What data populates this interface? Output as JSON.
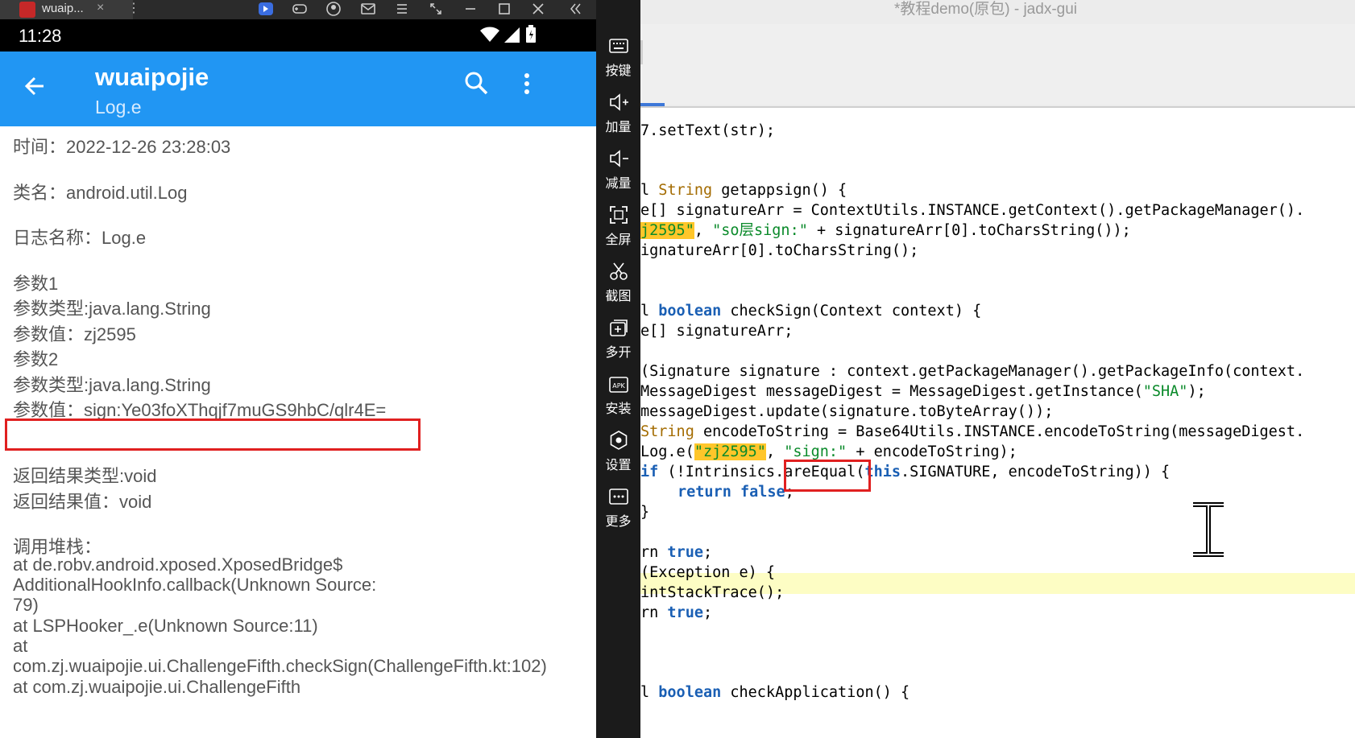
{
  "emulator": {
    "tab_title": "wuaip...",
    "tab_close": "×",
    "tab_more": "⋮"
  },
  "status_bar": {
    "time": "11:28"
  },
  "app_bar": {
    "title": "wuaipojie",
    "subtitle": "Log.e"
  },
  "log": {
    "time": "时间：2022-12-26 23:28:03",
    "class_name": "类名：android.util.Log",
    "log_name": "日志名称：Log.e",
    "param1": "参数1",
    "param1_type": "参数类型:java.lang.String",
    "param1_value": "参数值：zj2595",
    "param2": "参数2",
    "param2_type": "参数类型:java.lang.String",
    "param2_value": "参数值：sign:Ye03foXThqjf7muGS9hbC/qlr4E=",
    "return_type": "返回结果类型:void",
    "return_value": "返回结果值：void",
    "stack_title": "调用堆栈：",
    "stack": [
      "    at de.robv.android.xposed.XposedBridge$",
      "AdditionalHookInfo.callback(Unknown Source:",
      "79)",
      "    at LSPHooker_.e(Unknown Source:11)",
      "    at",
      "com.zj.wuaipojie.ui.ChallengeFifth.checkSign(ChallengeFifth.kt:102)",
      "    at com.zj.wuaipojie.ui.ChallengeFifth"
    ]
  },
  "side_toolbar": [
    {
      "label": "按键",
      "icon": "keyboard-icon"
    },
    {
      "label": "加量",
      "icon": "volume-up-icon"
    },
    {
      "label": "减量",
      "icon": "volume-down-icon"
    },
    {
      "label": "全屏",
      "icon": "fullscreen-icon"
    },
    {
      "label": "截图",
      "icon": "scissors-icon"
    },
    {
      "label": "多开",
      "icon": "multi-instance-icon"
    },
    {
      "label": "安装",
      "icon": "apk-install-icon"
    },
    {
      "label": "设置",
      "icon": "settings-icon"
    },
    {
      "label": "更多",
      "icon": "more-icon"
    }
  ],
  "ide": {
    "title": "*教程demo(原包) - jadx-gui",
    "code": {
      "l1": "7.setText(str);",
      "l2_a": "l ",
      "l2_type": "String",
      "l2_b": " getappsign() {",
      "l3": "e[] signatureArr = ContextUtils.INSTANCE.getContext().getPackageManager().",
      "l4_tag": "j2595\"",
      "l4_a": ", ",
      "l4_str": "\"so层sign:\"",
      "l4_b": " + signatureArr[0].toCharsString());",
      "l5": "ignatureArr[0].toCharsString();",
      "l6_a": "l ",
      "l6_kw": "boolean",
      "l6_b": " checkSign(Context context) {",
      "l7": "e[] signatureArr;",
      "l8": "(Signature signature : context.getPackageManager().getPackageInfo(context.",
      "l9_a": "MessageDigest messageDigest = MessageDigest.getInstance(",
      "l9_str": "\"SHA\"",
      "l9_b": ");",
      "l10": "messageDigest.update(signature.toByteArray());",
      "l11_type": "String",
      "l11_b": " encodeToString = Base64Utils.INSTANCE.encodeToString(messageDigest.",
      "l12_a": "Log.e(",
      "l12_tag": "\"zj2595\"",
      "l12_b": ", ",
      "l12_str": "\"sign:\"",
      "l12_c": " + encodeToString);",
      "l13_kw": "if",
      "l13_a": " (!Intrinsics.areEqual(",
      "l13_kw2": "this",
      "l13_b": ".SIGNATURE, encodeToString)) {",
      "l14_kw": "return",
      "l14_kw2": "false",
      "l14_b": ";",
      "l15": "}",
      "l16_a": "rn ",
      "l16_kw": "true",
      "l16_b": ";",
      "l17": "(Exception e) {",
      "l18": "intStackTrace();",
      "l19_a": "rn ",
      "l19_kw": "true",
      "l19_b": ";",
      "l20_a": "l ",
      "l20_kw": "boolean",
      "l20_b": " checkApplication() {"
    }
  },
  "colors": {
    "app_bar": "#2196f3",
    "highlight_box": "#e02020",
    "keyword": "#1a5fb4",
    "string": "#0a8a2a",
    "search_highlight": "#ffc62a"
  }
}
